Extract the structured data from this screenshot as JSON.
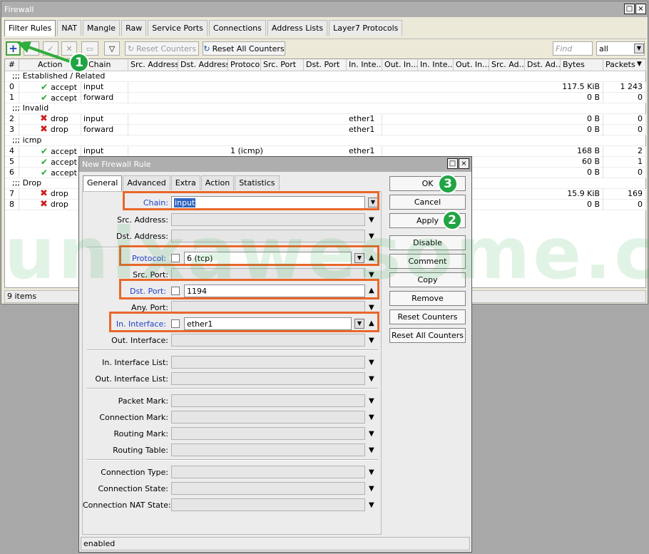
{
  "window": {
    "title": "Firewall"
  },
  "tabs": [
    "Filter Rules",
    "NAT",
    "Mangle",
    "Raw",
    "Service Ports",
    "Connections",
    "Address Lists",
    "Layer7 Protocols"
  ],
  "toolbar": {
    "reset_counters": "Reset Counters",
    "reset_all_counters": "Reset All Counters",
    "find_placeholder": "Find",
    "filter_value": "all"
  },
  "columns": [
    "#",
    "Action",
    "Chain",
    "Src. Address",
    "Dst. Address",
    "Protocol",
    "Src. Port",
    "Dst. Port",
    "In. Inte...",
    "Out. In...",
    "In. Inte...",
    "Out. In...",
    "Src. Ad...",
    "Dst. Ad...",
    "Bytes",
    "Packets"
  ],
  "rows": [
    {
      "comment": ";;; Established / Related"
    },
    {
      "num": "0",
      "action": "accept",
      "chain": "input",
      "protocol": "",
      "in_iface": "",
      "bytes": "117.5 KiB",
      "packets": "1 243"
    },
    {
      "num": "1",
      "action": "accept",
      "chain": "forward",
      "protocol": "",
      "in_iface": "",
      "bytes": "0 B",
      "packets": "0"
    },
    {
      "comment": ";;; Invalid"
    },
    {
      "num": "2",
      "action": "drop",
      "chain": "input",
      "protocol": "",
      "in_iface": "ether1",
      "bytes": "0 B",
      "packets": "0"
    },
    {
      "num": "3",
      "action": "drop",
      "chain": "forward",
      "protocol": "",
      "in_iface": "ether1",
      "bytes": "0 B",
      "packets": "0"
    },
    {
      "comment": ";;; icmp"
    },
    {
      "num": "4",
      "action": "accept",
      "chain": "input",
      "protocol": "1 (icmp)",
      "in_iface": "ether1",
      "bytes": "168 B",
      "packets": "2"
    },
    {
      "num": "5",
      "action": "accept",
      "chain": "",
      "protocol": "",
      "in_iface": "",
      "bytes": "60 B",
      "packets": "1"
    },
    {
      "num": "6",
      "action": "accept",
      "chain": "",
      "protocol": "",
      "in_iface": "",
      "bytes": "0 B",
      "packets": "0"
    },
    {
      "comment": ";;; Drop"
    },
    {
      "num": "7",
      "action": "drop",
      "chain": "",
      "protocol": "",
      "in_iface": "",
      "bytes": "15.9 KiB",
      "packets": "169"
    },
    {
      "num": "8",
      "action": "drop",
      "chain": "",
      "protocol": "",
      "in_iface": "",
      "bytes": "0 B",
      "packets": "0"
    }
  ],
  "status": {
    "items": "9 items"
  },
  "watermark": "unixawesome.com",
  "dialog": {
    "title": "New Firewall Rule",
    "tabs": [
      "General",
      "Advanced",
      "Extra",
      "Action",
      "Statistics"
    ],
    "fields": {
      "chain": {
        "label": "Chain:",
        "value": "input"
      },
      "src_address": {
        "label": "Src. Address:"
      },
      "dst_address": {
        "label": "Dst. Address:"
      },
      "protocol": {
        "label": "Protocol:",
        "value": "6 (tcp)"
      },
      "src_port": {
        "label": "Src. Port:"
      },
      "dst_port": {
        "label": "Dst. Port:",
        "value": "1194"
      },
      "any_port": {
        "label": "Any. Port:"
      },
      "in_interface": {
        "label": "In. Interface:",
        "value": "ether1"
      },
      "out_interface": {
        "label": "Out. Interface:"
      },
      "in_interface_list": {
        "label": "In. Interface List:"
      },
      "out_interface_list": {
        "label": "Out. Interface List:"
      },
      "packet_mark": {
        "label": "Packet Mark:"
      },
      "connection_mark": {
        "label": "Connection Mark:"
      },
      "routing_mark": {
        "label": "Routing Mark:"
      },
      "routing_table": {
        "label": "Routing Table:"
      },
      "connection_type": {
        "label": "Connection Type:"
      },
      "connection_state": {
        "label": "Connection State:"
      },
      "connection_nat_state": {
        "label": "Connection NAT State:"
      }
    },
    "buttons": {
      "ok": "OK",
      "cancel": "Cancel",
      "apply": "Apply",
      "disable": "Disable",
      "comment": "Comment",
      "copy": "Copy",
      "remove": "Remove",
      "reset_counters": "Reset Counters",
      "reset_all_counters": "Reset All Counters"
    },
    "status": "enabled"
  },
  "badges": {
    "one": "1",
    "two": "2",
    "three": "3"
  },
  "colors": {
    "accept": "#23a834",
    "drop": "#cc1d1d",
    "highlight": "#e8672a",
    "badge": "#21a443",
    "link_label": "#2241c9"
  }
}
